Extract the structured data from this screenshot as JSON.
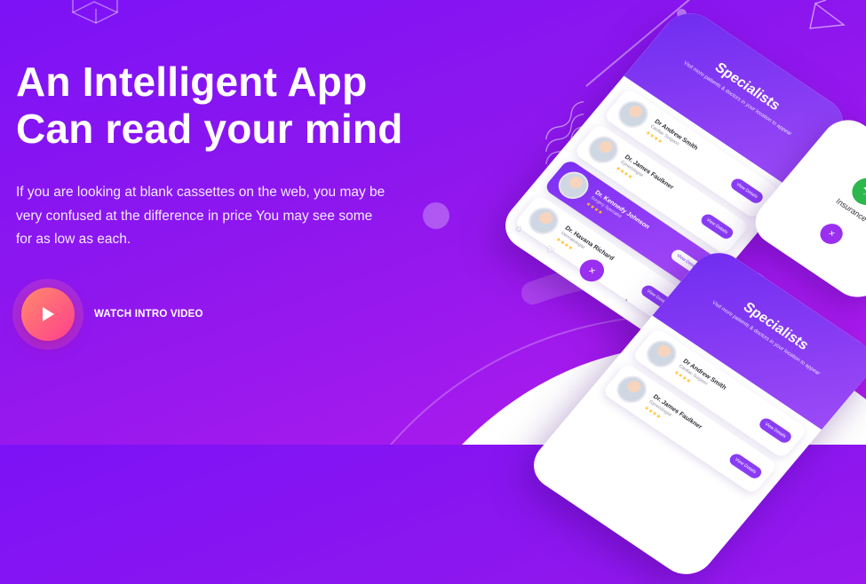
{
  "hero": {
    "title_line1": "An Intelligent App",
    "title_line2": "Can read your mind",
    "description": "If you are looking at blank cassettes on the web, you may be very confused at the difference in price You may see some for as low as each.",
    "video_label": "WATCH INTRO VIDEO"
  },
  "icons": {
    "play": "play-icon",
    "home": "home-icon",
    "heart": "heart-icon",
    "bell": "bell-icon",
    "user": "user-icon",
    "close": "close-icon",
    "insurance": "umbrella-icon"
  },
  "phone_main": {
    "title": "Specialists",
    "subtitle": "Visit more patients & doctors in your location to appear",
    "doctors": [
      {
        "name": "Dr Andrew Smith",
        "role": "Cardiac Surgeon",
        "stars": "★★★★",
        "rating": "4.8 (54 Reviews)",
        "button": "View Details"
      },
      {
        "name": "Dr. James Faulkner",
        "role": "Gynecologist",
        "stars": "★★★★",
        "rating": "4.8 (54 Reviews)",
        "button": "View Details"
      },
      {
        "name": "Dr. Kennedy Johnson",
        "role": "Surgery Specialist",
        "stars": "★★★★",
        "rating": "4.8 (54 Reviews)",
        "button": "View Details"
      },
      {
        "name": "Dr. Havana Richard",
        "role": "Dermatologist",
        "stars": "★★★★",
        "rating": "4.8 (54 Reviews)",
        "button": "View Details"
      }
    ],
    "fab": "×"
  },
  "phone_second": {
    "title": "Specialists",
    "subtitle": "Visit more patients & doctors in your location to appear",
    "doctors": [
      {
        "name": "Dr Andrew Smith",
        "role": "Cardiac Surgeon",
        "stars": "★★★★",
        "button": "View Details"
      },
      {
        "name": "Dr. James Faulkner",
        "role": "Gynecologist",
        "stars": "★★★★",
        "button": "View Details"
      }
    ]
  },
  "phone_side": {
    "label": "Insurance",
    "fab": "×"
  },
  "colors": {
    "bg_start": "#7d12f6",
    "bg_end": "#b21cec",
    "play_start": "#ff8a6b",
    "play_end": "#ff3f8d",
    "accent": "#8a3cf4",
    "star": "#ffc02d",
    "insurance_green": "#2cb84c"
  }
}
